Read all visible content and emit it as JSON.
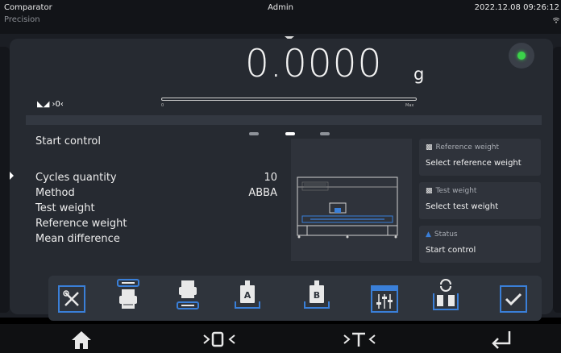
{
  "header": {
    "app_name": "Comparator",
    "mode": "Precision",
    "user": "Admin",
    "datetime": "2022.12.08 09:26:12"
  },
  "display": {
    "weight": "0.0000",
    "unit": "g",
    "status_icons": "◣◢ ›0‹",
    "bargraph_min": "0",
    "bargraph_max": "Max",
    "bargraph_fill_percent": 0,
    "stability_led_color": "#3bd24a"
  },
  "procedure": {
    "title": "Start control",
    "pager_total": 3,
    "pager_active": 2,
    "params": [
      {
        "label": "Cycles quantity",
        "value": "10"
      },
      {
        "label": "Method",
        "value": "ABBA"
      },
      {
        "label": "Test weight",
        "value": ""
      },
      {
        "label": "Reference weight",
        "value": ""
      },
      {
        "label": "Mean difference",
        "value": ""
      }
    ]
  },
  "cards": [
    {
      "title": "Reference weight",
      "value": "Select reference weight",
      "icon": "weight-icon"
    },
    {
      "title": "Test weight",
      "value": "Select test weight",
      "icon": "weight-icon"
    },
    {
      "title": "Status",
      "value": "Start control",
      "icon": "status-icon"
    }
  ],
  "toolbar": {
    "buttons": [
      {
        "name": "tools-button",
        "icon": "tools-icon"
      },
      {
        "name": "printout-header-button",
        "icon": "print-header-icon"
      },
      {
        "name": "printout-footer-button",
        "icon": "print-footer-icon"
      },
      {
        "name": "weight-a-button",
        "icon": "weight-a-icon"
      },
      {
        "name": "weight-b-button",
        "icon": "weight-b-icon"
      },
      {
        "name": "settings-button",
        "icon": "sliders-icon"
      },
      {
        "name": "change-weights-button",
        "icon": "swap-weights-icon"
      },
      {
        "name": "confirm-button",
        "icon": "check-icon"
      }
    ]
  },
  "navigation": {
    "items": [
      {
        "name": "home",
        "icon": "home-icon"
      },
      {
        "name": "zero",
        "icon": "zero-icon"
      },
      {
        "name": "tare",
        "icon": "tare-icon"
      },
      {
        "name": "enter",
        "icon": "enter-icon"
      }
    ]
  },
  "colors": {
    "accent": "#3a7fd8",
    "background": "#262a31"
  }
}
